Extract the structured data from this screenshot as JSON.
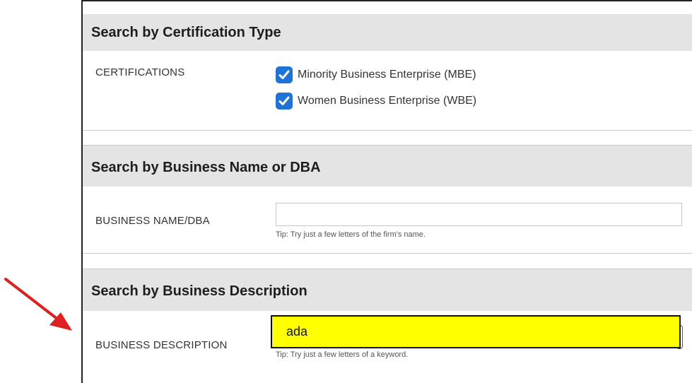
{
  "sections": {
    "certification": {
      "title": "Search by Certification Type",
      "label": "CERTIFICATIONS",
      "options": [
        {
          "label": "Minority Business Enterprise (MBE)",
          "checked": true
        },
        {
          "label": "Women Business Enterprise (WBE)",
          "checked": true
        }
      ]
    },
    "business_name": {
      "title": "Search by Business Name or DBA",
      "label": "BUSINESS NAME/DBA",
      "value": "",
      "tip": "Tip: Try just a few letters of the firm's name."
    },
    "business_description": {
      "title": "Search by Business Description",
      "label": "BUSINESS DESCRIPTION",
      "value": "ada",
      "tip": "Tip: Try just a few letters of a keyword."
    }
  },
  "colors": {
    "checkbox": "#1e73d8",
    "header_bg": "#e4e4e4",
    "highlight": "#ffff00",
    "arrow": "#e02020"
  },
  "icons": {
    "checkbox": "checkmark-icon",
    "annotation": "red-arrow-icon"
  }
}
